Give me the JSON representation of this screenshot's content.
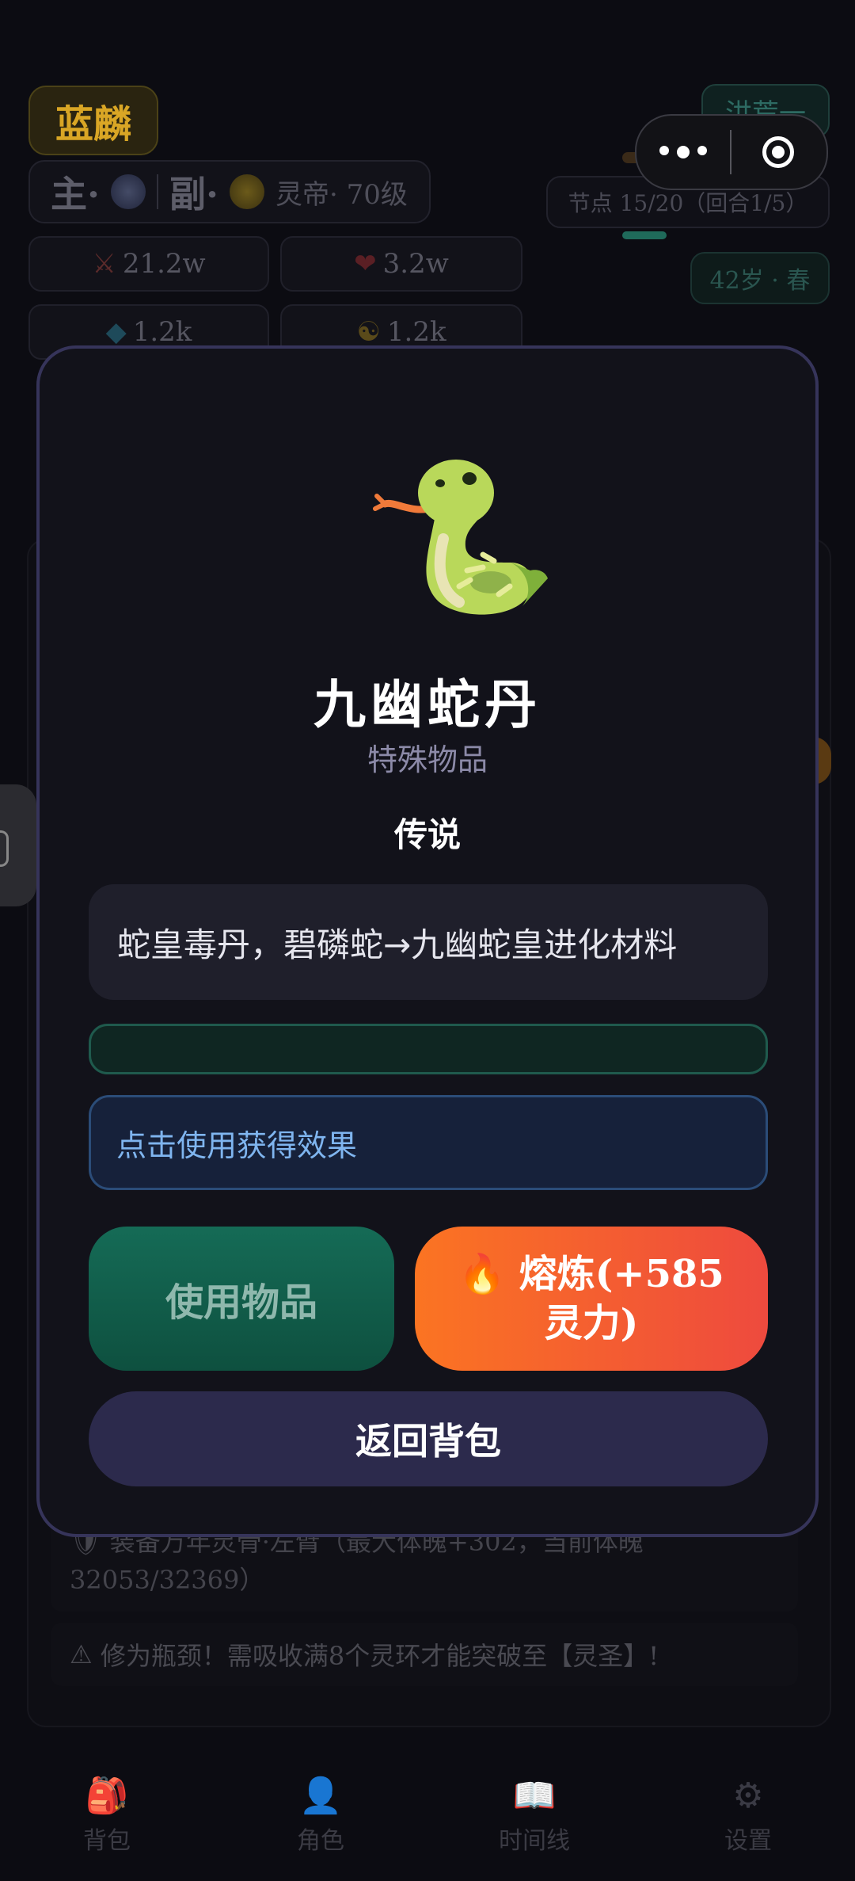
{
  "header": {
    "realm_tag": "蓝麟",
    "right_tag": "洪荒一",
    "main_label": "主·",
    "sub_label": "副·",
    "level": "灵帝· 70级",
    "node_progress": "节点 15/20（回合1/5）",
    "age": "42岁 · 春"
  },
  "stats": {
    "attack": "21.2w",
    "hp": "3.2w",
    "defense": "1.2k",
    "spirit": "1.2k"
  },
  "background_log": {
    "line1": "装备万年灵骨·左臂（最大体魄+302，当前体魄32053/32369）",
    "line2": "修为瓶颈！需吸收满8个灵环才能突破至【灵圣】!"
  },
  "tabs": [
    {
      "label": "背包",
      "icon": "backpack-icon"
    },
    {
      "label": "角色",
      "icon": "person-icon"
    },
    {
      "label": "时间线",
      "icon": "book-icon"
    },
    {
      "label": "设置",
      "icon": "gear-icon"
    }
  ],
  "modal": {
    "icon": "snake-icon",
    "name": "九幽蛇丹",
    "type": "特殊物品",
    "rarity": "传说",
    "description": "蛇皇毒丹，碧磷蛇→九幽蛇皇进化材料",
    "hint": "点击使用获得效果",
    "use_label": "使用物品",
    "smelt_label": "🔥 熔炼(+585灵力)",
    "back_label": "返回背包"
  },
  "colors": {
    "modal_border": "#36345a",
    "use_button": "#156b56",
    "smelt_start": "#fb7422",
    "smelt_end": "#ee4a3e",
    "back_button": "#2c2a4c"
  }
}
